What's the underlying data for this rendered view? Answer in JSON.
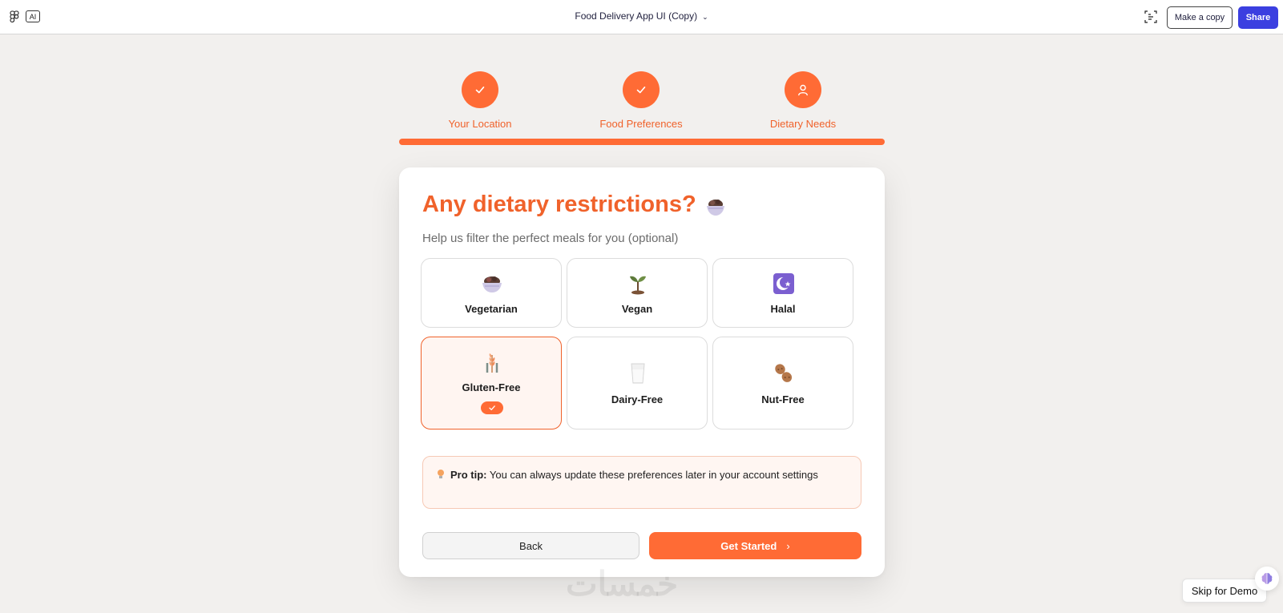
{
  "topbar": {
    "ai_badge": "AI",
    "title": "Food Delivery App UI (Copy)",
    "make_copy": "Make a copy",
    "share": "Share",
    "icons": [
      "figma-logo-icon",
      "chevron-down-icon",
      "dev-mode-icon"
    ]
  },
  "steps": [
    {
      "label": "Your Location",
      "icon": "check-icon",
      "status": "completed"
    },
    {
      "label": "Food Preferences",
      "icon": "check-icon",
      "status": "completed"
    },
    {
      "label": "Dietary Needs",
      "icon": "user-icon",
      "status": "current"
    }
  ],
  "progress_fraction": 1.0,
  "card": {
    "title": "Any dietary restrictions?",
    "title_icon": "salad-bowl-icon",
    "subtitle": "Help us filter the perfect meals for you (optional)",
    "options": [
      {
        "label": "Vegetarian",
        "icon": "salad-bowl-icon",
        "selected": false
      },
      {
        "label": "Vegan",
        "icon": "seedling-icon",
        "selected": false
      },
      {
        "label": "Halal",
        "icon": "crescent-star-icon",
        "selected": false
      },
      {
        "label": "Gluten-Free",
        "icon": "wheat-icon",
        "selected": true
      },
      {
        "label": "Dairy-Free",
        "icon": "milk-glass-icon",
        "selected": false
      },
      {
        "label": "Nut-Free",
        "icon": "peanut-icon",
        "selected": false
      }
    ],
    "tip_label": "Pro tip:",
    "tip_text": " You can always update these preferences later in your account settings",
    "back": "Back",
    "get_started": "Get Started",
    "accent_color": "#ff6b35"
  },
  "footer": {
    "skip": "Skip for Demo",
    "assistant_icon": "brain-icon"
  }
}
